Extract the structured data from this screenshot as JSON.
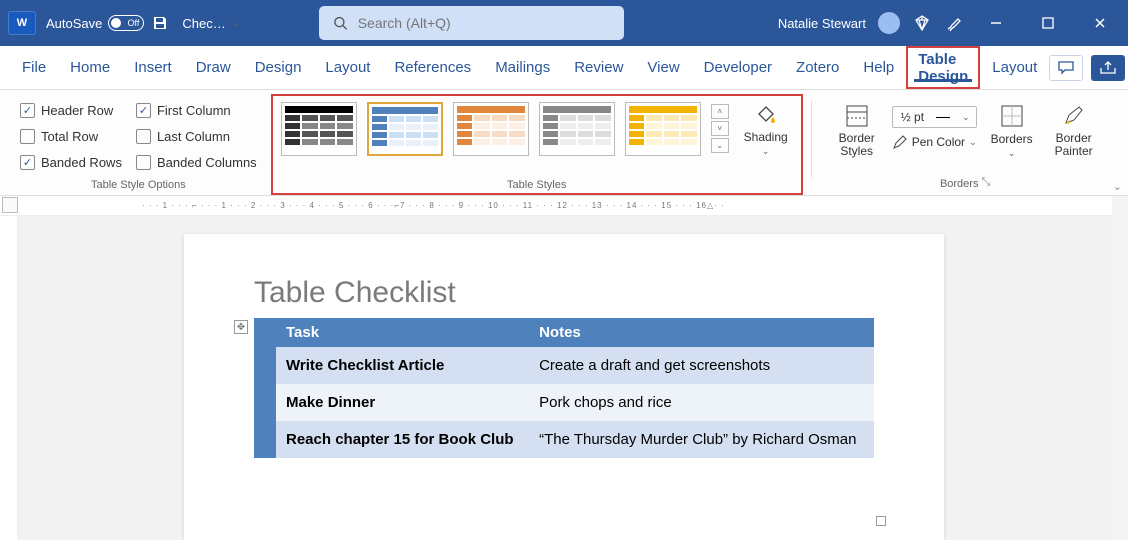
{
  "titlebar": {
    "autosave_label": "AutoSave",
    "autosave_state": "Off",
    "doc_name": "Chec…",
    "search_placeholder": "Search (Alt+Q)",
    "user_name": "Natalie Stewart"
  },
  "tabs": {
    "file": "File",
    "home": "Home",
    "insert": "Insert",
    "draw": "Draw",
    "design": "Design",
    "layout": "Layout",
    "references": "References",
    "mailings": "Mailings",
    "review": "Review",
    "view": "View",
    "developer": "Developer",
    "zotero": "Zotero",
    "help": "Help",
    "table_design": "Table Design",
    "tlayout": "Layout"
  },
  "ribbon": {
    "opts": {
      "header_row": "Header Row",
      "total_row": "Total Row",
      "banded_rows": "Banded Rows",
      "first_column": "First Column",
      "last_column": "Last Column",
      "banded_columns": "Banded Columns",
      "group_label": "Table Style Options"
    },
    "styles": {
      "group_label": "Table Styles",
      "shading": "Shading"
    },
    "borders": {
      "border_styles": "Border\nStyles",
      "pen_width": "½ pt",
      "pen_color": "Pen Color",
      "borders_btn": "Borders",
      "border_painter": "Border\nPainter",
      "group_label": "Borders"
    }
  },
  "ruler_text": "· · · 1 · · · ⌐ · · · 1 · · · 2 · · · 3 · · · 4 · · · 5 · · · 6 · · ·⌐7 · · · 8 · · · 9 · · · 10 · · · 11 · · · 12 · · · 13 · · · 14 · · · 15 · · · 16△· ·",
  "document": {
    "title": "Table Checklist",
    "headers": {
      "c1": "Task",
      "c2": "Notes"
    },
    "rows": [
      {
        "c1": "Write Checklist Article",
        "c2": "Create a draft and get screenshots"
      },
      {
        "c1": "Make Dinner",
        "c2": "Pork chops and rice"
      },
      {
        "c1": "Reach chapter 15 for Book Club",
        "c2": "“The Thursday Murder Club” by Richard Osman"
      }
    ]
  }
}
